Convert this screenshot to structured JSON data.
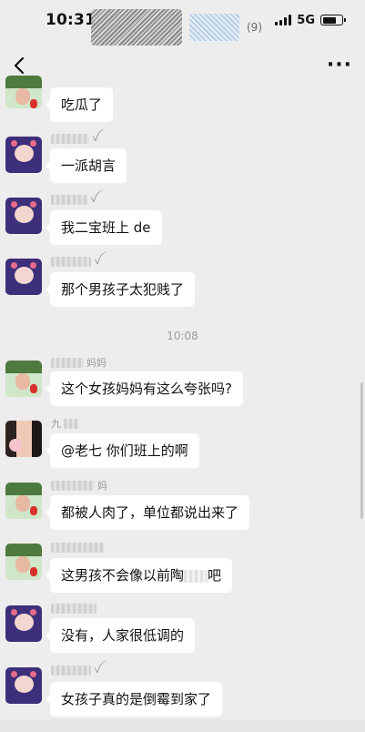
{
  "status_bar": {
    "time": "10:31",
    "network": "5G",
    "battery_level": 0.7
  },
  "nav": {
    "member_count": "(9)",
    "back_icon": "chevron-left-icon",
    "more_label": "···"
  },
  "chat": {
    "time_divider": "10:08",
    "messages": [
      {
        "sender_suffix": "",
        "text": "吃瓜了",
        "avatar": "green"
      },
      {
        "sender_suffix": "ꪜ",
        "text": "一派胡言",
        "avatar": "cartoon"
      },
      {
        "sender_suffix": "ꪜ",
        "text": "我二宝班上 de",
        "avatar": "cartoon"
      },
      {
        "sender_suffix": "ꪜ",
        "text": "那个男孩子太犯贱了",
        "avatar": "cartoon"
      },
      {
        "sender_suffix": "妈妈",
        "text": "这个女孩妈妈有这么夸张吗?",
        "avatar": "green"
      },
      {
        "sender_suffix": "九",
        "text": "@老七 你们班上的啊",
        "avatar": "girl"
      },
      {
        "sender_suffix": "妈",
        "text": "都被人肉了，单位都说出来了",
        "avatar": "green"
      },
      {
        "sender_suffix": "",
        "text_before": "这男孩不会像以前陶",
        "text_after": "吧",
        "avatar": "green"
      },
      {
        "sender_suffix": "",
        "text": "没有，人家很低调的",
        "avatar": "cartoon"
      },
      {
        "sender_suffix": "ꪜ",
        "text": "女孩子真的是倒霉到家了",
        "avatar": "cartoon"
      }
    ]
  }
}
